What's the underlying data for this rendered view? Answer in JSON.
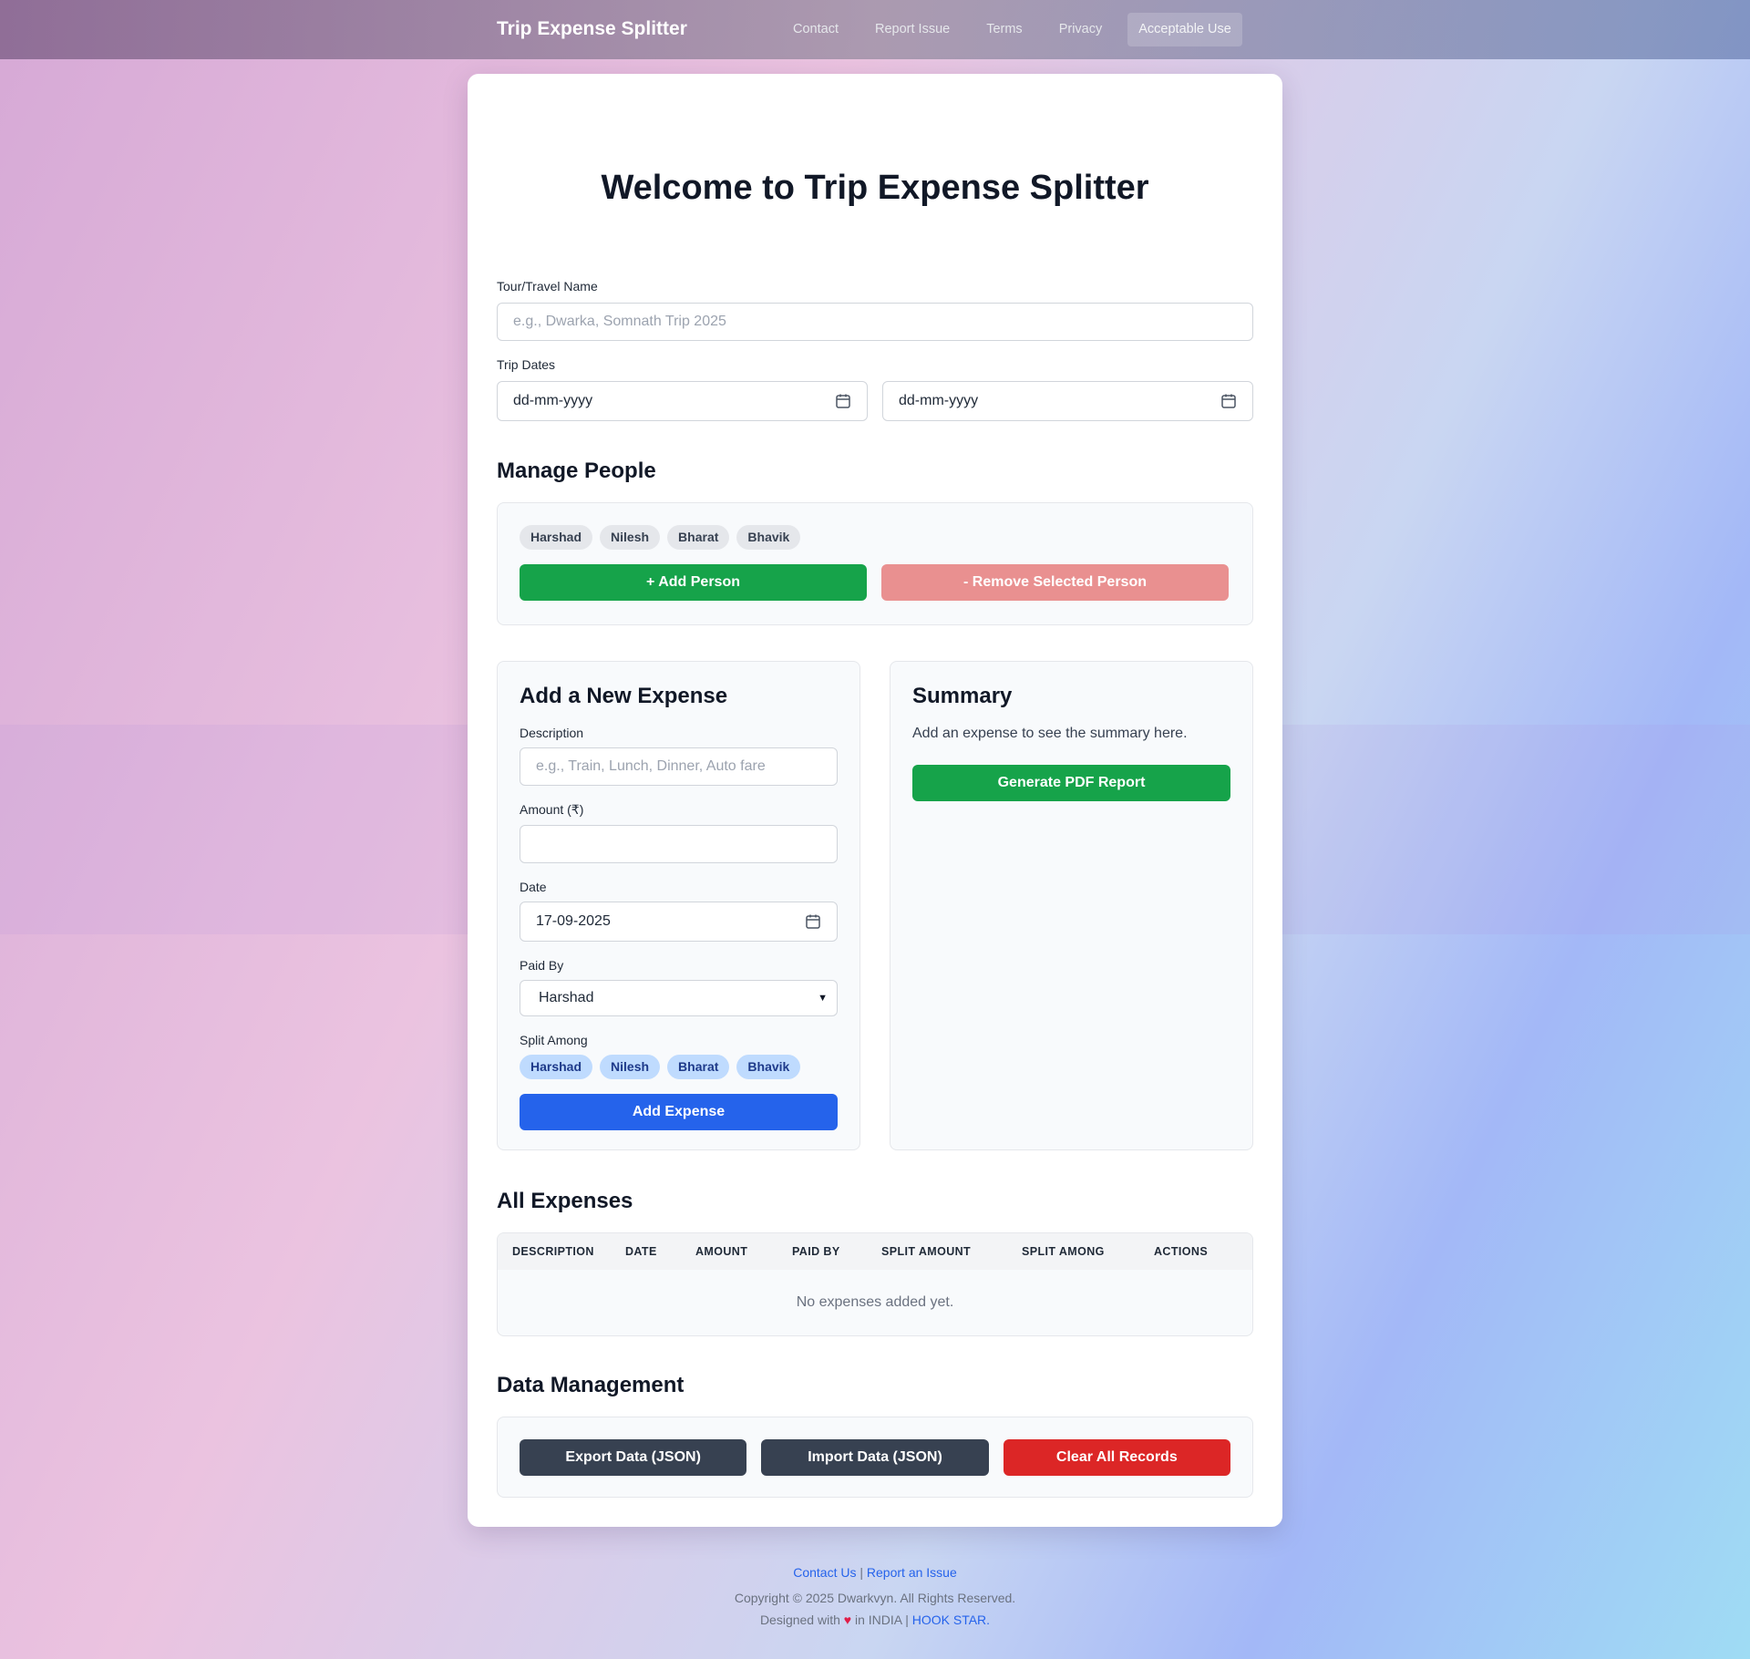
{
  "nav": {
    "brand": "Trip Expense Splitter",
    "links": [
      "Contact",
      "Report Issue",
      "Terms",
      "Privacy",
      "Acceptable Use"
    ],
    "active": "Acceptable Use"
  },
  "title": "Welcome to Trip Expense Splitter",
  "trip": {
    "name_label": "Tour/Travel Name",
    "name_placeholder": "e.g., Dwarka, Somnath Trip 2025",
    "dates_label": "Trip Dates",
    "start_date": "dd-mm-yyyy",
    "end_date": "dd-mm-yyyy"
  },
  "people": {
    "heading": "Manage People",
    "list": [
      "Harshad",
      "Nilesh",
      "Bharat",
      "Bhavik"
    ],
    "add_label": "+ Add Person",
    "remove_label": "- Remove Selected Person"
  },
  "expense_form": {
    "heading": "Add a New Expense",
    "description_label": "Description",
    "description_placeholder": "e.g., Train, Lunch, Dinner, Auto fare",
    "amount_label": "Amount (₹)",
    "amount_value": "",
    "date_label": "Date",
    "date_value": "17-09-2025",
    "paid_by_label": "Paid By",
    "paid_by_value": "Harshad",
    "split_label": "Split Among",
    "split_people": [
      "Harshad",
      "Nilesh",
      "Bharat",
      "Bhavik"
    ],
    "submit_label": "Add Expense"
  },
  "summary": {
    "heading": "Summary",
    "text": "Add an expense to see the summary here.",
    "pdf_label": "Generate PDF Report"
  },
  "expenses": {
    "heading": "All Expenses",
    "columns": [
      "DESCRIPTION",
      "DATE",
      "AMOUNT",
      "PAID BY",
      "SPLIT AMOUNT",
      "SPLIT AMONG",
      "ACTIONS"
    ],
    "empty_text": "No expenses added yet."
  },
  "data_mgmt": {
    "heading": "Data Management",
    "export_label": "Export Data (JSON)",
    "import_label": "Import Data (JSON)",
    "clear_label": "Clear All Records"
  },
  "footer": {
    "contact": "Contact Us",
    "separator": "|",
    "report": "Report an Issue",
    "copyright": "Copyright © 2025 Dwarkvyn. All Rights Reserved.",
    "designed_prefix": "Designed with",
    "heart": "♥",
    "designed_suffix": "in INDIA",
    "studio": "HOOK STAR."
  },
  "colors": {
    "primary_green": "#16a34a",
    "primary_blue": "#2563eb",
    "danger_red": "#dc2626",
    "muted_red": "#e99090",
    "slate": "#374151"
  }
}
